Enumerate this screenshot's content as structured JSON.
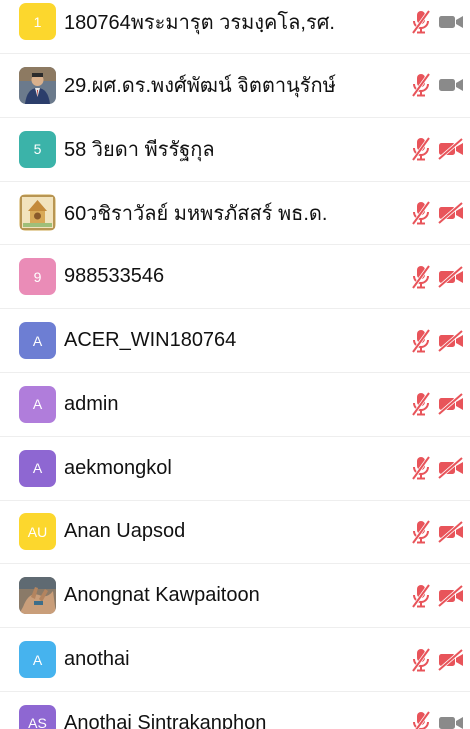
{
  "participants": [
    {
      "name": "180764พระมารุต วรมงฺคโล,รศ.",
      "initials": "1",
      "avatar_type": "initials",
      "avatar_color": "#FCD72D",
      "mic": "muted",
      "video": "off-gray"
    },
    {
      "name": "29.ผศ.ดร.พงศ์พัฒน์ จิตตานุรักษ์",
      "initials": "",
      "avatar_type": "photo-man-suit",
      "avatar_color": "#6b5a4a",
      "mic": "muted",
      "video": "off-gray"
    },
    {
      "name": "58 วิยดา พีรรัฐกุล",
      "initials": "5",
      "avatar_type": "initials",
      "avatar_color": "#3BB3A9",
      "mic": "muted",
      "video": "off-red"
    },
    {
      "name": "60วชิราวัลย์ มหพรภัสสร์ พธ.ด.",
      "initials": "",
      "avatar_type": "photo-temple",
      "avatar_color": "#c9a96a",
      "mic": "muted",
      "video": "off-red"
    },
    {
      "name": "988533546",
      "initials": "9",
      "avatar_type": "initials",
      "avatar_color": "#EA8CB7",
      "mic": "muted",
      "video": "off-red"
    },
    {
      "name": "ACER_WIN180764",
      "initials": "A",
      "avatar_type": "initials",
      "avatar_color": "#6D7ED3",
      "mic": "muted",
      "video": "off-red"
    },
    {
      "name": "admin",
      "initials": "A",
      "avatar_type": "initials",
      "avatar_color": "#B07DDB",
      "mic": "muted",
      "video": "off-red"
    },
    {
      "name": "aekmongkol",
      "initials": "A",
      "avatar_type": "initials",
      "avatar_color": "#8E67D2",
      "mic": "muted",
      "video": "off-red"
    },
    {
      "name": "Anan Uapsod",
      "initials": "AU",
      "avatar_type": "initials",
      "avatar_color": "#FCD72D",
      "mic": "muted",
      "video": "off-red"
    },
    {
      "name": "Anongnat Kawpaitoon",
      "initials": "",
      "avatar_type": "photo-hands",
      "avatar_color": "#7a6a58",
      "mic": "muted",
      "video": "off-red"
    },
    {
      "name": "anothai",
      "initials": "A",
      "avatar_type": "initials",
      "avatar_color": "#46B3EE",
      "mic": "muted",
      "video": "off-red"
    },
    {
      "name": "Anothai Sintrakanphon",
      "initials": "AS",
      "avatar_type": "initials",
      "avatar_color": "#8E67D2",
      "mic": "muted",
      "video": "off-gray"
    }
  ],
  "colors": {
    "red": "#E8545A",
    "gray": "#8A8A8A"
  }
}
